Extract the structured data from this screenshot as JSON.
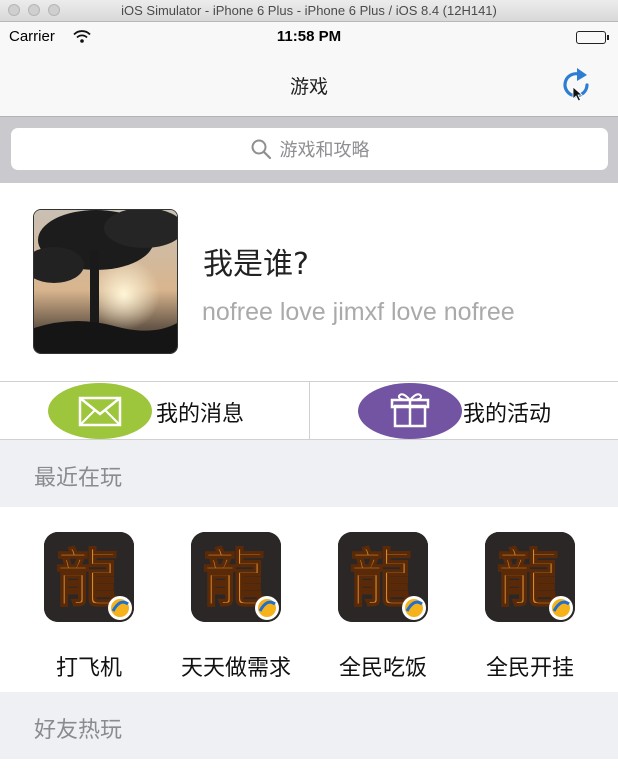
{
  "window": {
    "title": "iOS Simulator - iPhone 6 Plus - iPhone 6 Plus / iOS 8.4 (12H141)"
  },
  "status_bar": {
    "carrier": "Carrier",
    "time": "11:58 PM"
  },
  "nav": {
    "title": "游戏",
    "refresh_icon": "refresh-icon"
  },
  "search": {
    "placeholder": "游戏和攻略"
  },
  "profile": {
    "name": "我是谁?",
    "subtitle": "nofree love jimxf love nofree"
  },
  "actions": [
    {
      "label": "我的消息",
      "icon": "envelope-icon",
      "color": "#9ec63c"
    },
    {
      "label": "我的活动",
      "icon": "gift-icon",
      "color": "#7354a2"
    }
  ],
  "sections": {
    "recent": "最近在玩",
    "friends": "好友热玩"
  },
  "games": [
    {
      "name": "打飞机"
    },
    {
      "name": "天天做需求"
    },
    {
      "name": "全民吃饭"
    },
    {
      "name": "全民开挂"
    }
  ],
  "colors": {
    "accent": "#2d7dd2",
    "section_bg": "#eff0f4",
    "search_bg": "#c9c9ce"
  }
}
